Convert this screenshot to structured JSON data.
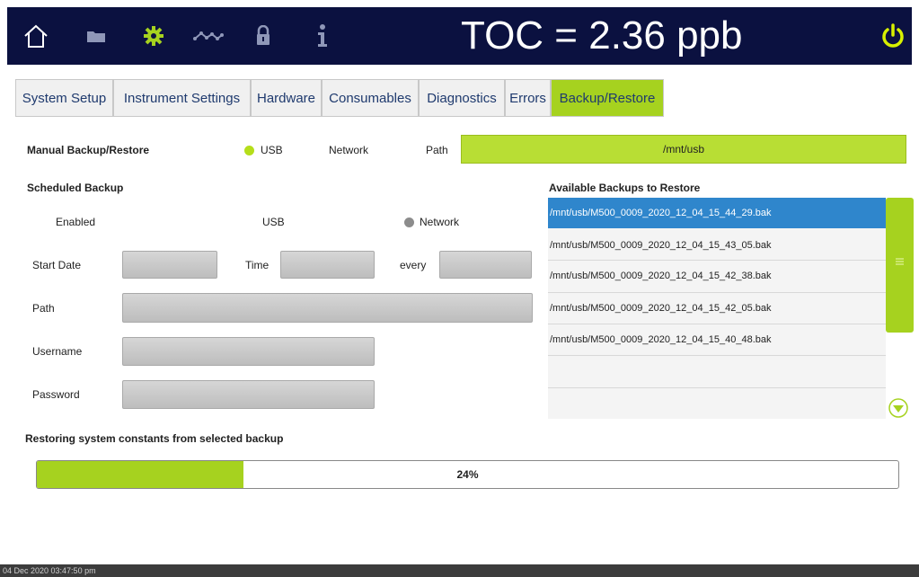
{
  "header": {
    "icons": [
      "home-icon",
      "folder-icon",
      "gear-icon",
      "trend-icon",
      "lock-icon",
      "info-icon"
    ],
    "toc_reading": "TOC = 2.36 ppb",
    "power_icon": "power-icon",
    "colors": {
      "background": "#0b1140",
      "accent": "#a6d21f",
      "text": "#ffffff"
    }
  },
  "tabs": [
    {
      "label": "System Setup",
      "active": false
    },
    {
      "label": "Instrument Settings",
      "active": false
    },
    {
      "label": "Hardware",
      "active": false
    },
    {
      "label": "Consumables",
      "active": false
    },
    {
      "label": "Diagnostics",
      "active": false
    },
    {
      "label": "Errors",
      "active": false
    },
    {
      "label": "Backup/Restore",
      "active": true
    }
  ],
  "manual": {
    "title": "Manual Backup/Restore",
    "usb_label": "USB",
    "network_label": "Network",
    "usb_selected": true,
    "path_label": "Path",
    "path_value": "/mnt/usb"
  },
  "scheduled": {
    "title": "Scheduled Backup",
    "enabled_label": "Enabled",
    "usb_label": "USB",
    "network_label": "Network",
    "start_date_label": "Start Date",
    "start_date_value": "",
    "time_label": "Time",
    "time_value": "",
    "every_label": "every",
    "every_value": "",
    "path_label": "Path",
    "path_value": "",
    "username_label": "Username",
    "username_value": "",
    "password_label": "Password",
    "password_value": ""
  },
  "available": {
    "title": "Available Backups to Restore",
    "items": [
      "/mnt/usb/M500_0009_2020_12_04_15_44_29.bak",
      "/mnt/usb/M500_0009_2020_12_04_15_43_05.bak",
      "/mnt/usb/M500_0009_2020_12_04_15_42_38.bak",
      "/mnt/usb/M500_0009_2020_12_04_15_42_05.bak",
      "/mnt/usb/M500_0009_2020_12_04_15_40_48.bak"
    ],
    "selected_index": 0
  },
  "restore": {
    "status": "Restoring system constants from selected backup",
    "progress_text": "24%",
    "progress_fraction": 0.24
  },
  "footer": {
    "datetime": "04 Dec 2020 03:47:50 pm"
  }
}
